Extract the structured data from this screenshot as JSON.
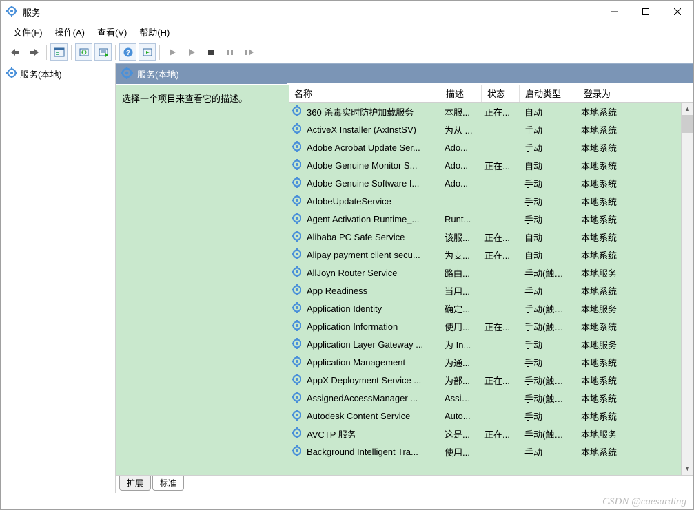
{
  "window": {
    "title": "服务"
  },
  "menu": {
    "file": "文件(F)",
    "action": "操作(A)",
    "view": "查看(V)",
    "help": "帮助(H)"
  },
  "tree": {
    "root": "服务(本地)"
  },
  "header": {
    "label": "服务(本地)"
  },
  "desc": {
    "hint": "选择一个项目来查看它的描述。"
  },
  "columns": {
    "name": "名称",
    "desc": "描述",
    "status": "状态",
    "startup": "启动类型",
    "logon": "登录为"
  },
  "tabs": {
    "extended": "扩展",
    "standard": "标准"
  },
  "watermark": "CSDN @caesarding",
  "services": [
    {
      "n": "360 杀毒实时防护加载服务",
      "d": "本服...",
      "s": "正在...",
      "t": "自动",
      "l": "本地系统"
    },
    {
      "n": "ActiveX Installer (AxInstSV)",
      "d": "为从 ...",
      "s": "",
      "t": "手动",
      "l": "本地系统"
    },
    {
      "n": "Adobe Acrobat Update Ser...",
      "d": "Ado...",
      "s": "",
      "t": "手动",
      "l": "本地系统"
    },
    {
      "n": "Adobe Genuine Monitor S...",
      "d": "Ado...",
      "s": "正在...",
      "t": "自动",
      "l": "本地系统"
    },
    {
      "n": "Adobe Genuine Software I...",
      "d": "Ado...",
      "s": "",
      "t": "手动",
      "l": "本地系统"
    },
    {
      "n": "AdobeUpdateService",
      "d": "",
      "s": "",
      "t": "手动",
      "l": "本地系统"
    },
    {
      "n": "Agent Activation Runtime_...",
      "d": "Runt...",
      "s": "",
      "t": "手动",
      "l": "本地系统"
    },
    {
      "n": "Alibaba PC Safe Service",
      "d": "该服...",
      "s": "正在...",
      "t": "自动",
      "l": "本地系统"
    },
    {
      "n": "Alipay payment client secu...",
      "d": "为支...",
      "s": "正在...",
      "t": "自动",
      "l": "本地系统"
    },
    {
      "n": "AllJoyn Router Service",
      "d": "路由...",
      "s": "",
      "t": "手动(触发...",
      "l": "本地服务"
    },
    {
      "n": "App Readiness",
      "d": "当用...",
      "s": "",
      "t": "手动",
      "l": "本地系统"
    },
    {
      "n": "Application Identity",
      "d": "确定...",
      "s": "",
      "t": "手动(触发...",
      "l": "本地服务"
    },
    {
      "n": "Application Information",
      "d": "使用...",
      "s": "正在...",
      "t": "手动(触发...",
      "l": "本地系统"
    },
    {
      "n": "Application Layer Gateway ...",
      "d": "为 In...",
      "s": "",
      "t": "手动",
      "l": "本地服务"
    },
    {
      "n": "Application Management",
      "d": "为通...",
      "s": "",
      "t": "手动",
      "l": "本地系统"
    },
    {
      "n": "AppX Deployment Service ...",
      "d": "为部...",
      "s": "正在...",
      "t": "手动(触发...",
      "l": "本地系统"
    },
    {
      "n": "AssignedAccessManager ...",
      "d": "Assig...",
      "s": "",
      "t": "手动(触发...",
      "l": "本地系统"
    },
    {
      "n": "Autodesk Content Service",
      "d": "Auto...",
      "s": "",
      "t": "手动",
      "l": "本地系统"
    },
    {
      "n": "AVCTP 服务",
      "d": "这是...",
      "s": "正在...",
      "t": "手动(触发...",
      "l": "本地服务"
    },
    {
      "n": "Background Intelligent Tra...",
      "d": "使用...",
      "s": "",
      "t": "手动",
      "l": "本地系统"
    }
  ]
}
